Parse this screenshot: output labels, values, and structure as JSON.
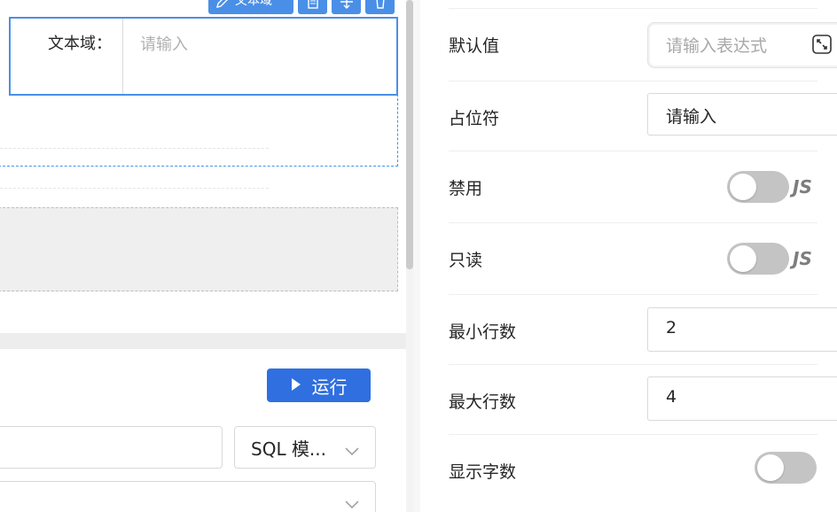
{
  "canvas": {
    "toolbar": {
      "component_label": "文本域"
    },
    "textarea_field": {
      "label": "文本域：",
      "placeholder": "请输入"
    },
    "run_button": {
      "label": "运行"
    },
    "sql_mode_select": {
      "value": "SQL 模..."
    }
  },
  "panel": {
    "default_value": {
      "label": "默认值",
      "placeholder": "请输入表达式"
    },
    "placeholder": {
      "label": "占位符",
      "value": "请输入"
    },
    "disabled": {
      "label": "禁用",
      "on": false,
      "js": "JS"
    },
    "readonly": {
      "label": "只读",
      "on": false,
      "js": "JS"
    },
    "min_rows": {
      "label": "最小行数",
      "value": "2"
    },
    "max_rows": {
      "label": "最大行数",
      "value": "4"
    },
    "show_count": {
      "label": "显示字数",
      "on": false
    }
  },
  "colors": {
    "accent": "#4a8fe7",
    "primary_button": "#2f6fe0",
    "toggle_off": "#c4c4c4"
  },
  "icons": [
    "edit-icon",
    "copy-icon",
    "move-icon",
    "delete-icon",
    "play-icon",
    "chevron-down-icon",
    "expand-icon"
  ]
}
